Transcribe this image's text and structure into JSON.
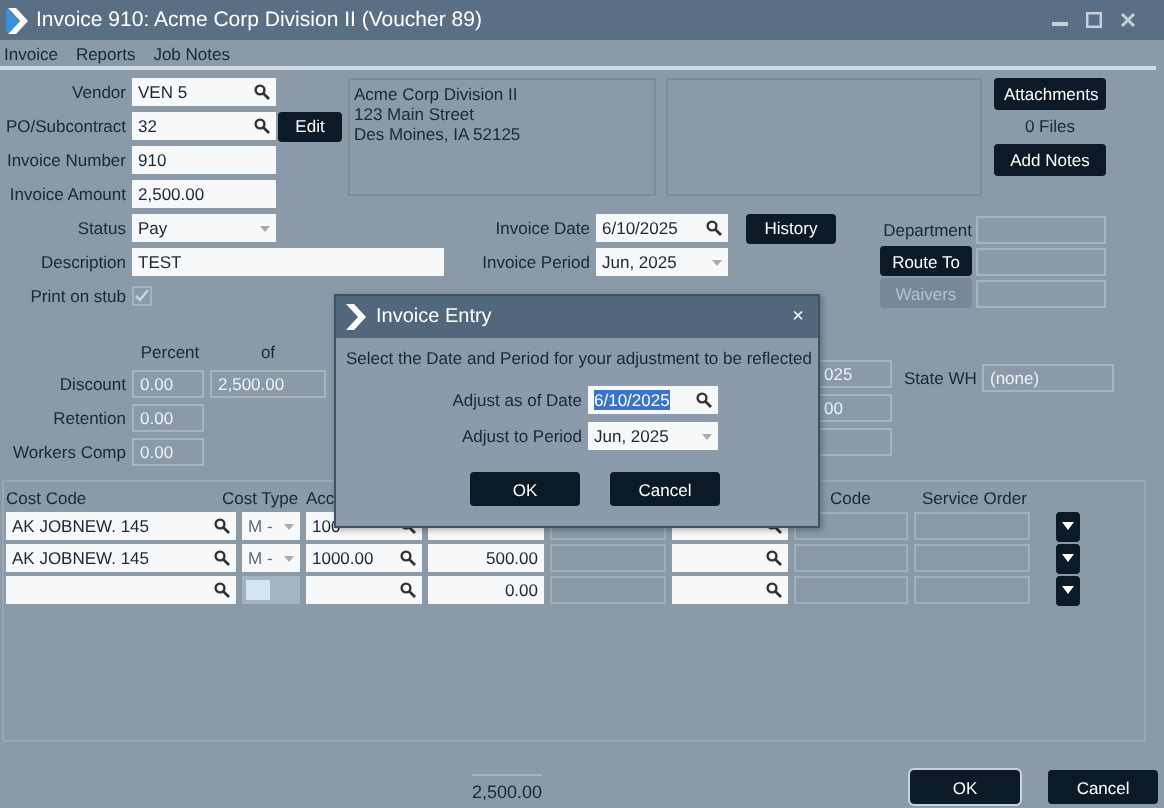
{
  "window": {
    "title": "Invoice 910: Acme Corp Division II (Voucher 89)"
  },
  "menu": [
    {
      "label": "Invoice"
    },
    {
      "label": "Reports"
    },
    {
      "label": "Job Notes"
    }
  ],
  "header_fields": [
    {
      "label": "Vendor",
      "value": "VEN 5",
      "kind": "search"
    },
    {
      "label": "PO/Subcontract",
      "value": "32",
      "kind": "search"
    },
    {
      "label": "Invoice Number",
      "value": "910",
      "kind": "text"
    },
    {
      "label": "Invoice Amount",
      "value": "2,500.00",
      "kind": "text"
    }
  ],
  "edit_button": "Edit",
  "address": {
    "lines": [
      "Acme Corp Division II",
      "123 Main Street",
      "Des Moines, IA 52125"
    ]
  },
  "attachments": {
    "button": "Attachments",
    "count": "0 Files",
    "notes_button": "Add Notes"
  },
  "detail_fields": [
    {
      "label": "Status",
      "value": "Pay",
      "kind": "select"
    },
    {
      "label": "Description",
      "value": "TEST",
      "kind": "wide"
    },
    {
      "label": "Print on stub",
      "kind": "checkbox",
      "checked": true
    }
  ],
  "date_fields": [
    {
      "label": "Invoice Date",
      "value": "6/10/2025",
      "kind": "search"
    },
    {
      "label": "Invoice Period",
      "value": "Jun, 2025",
      "kind": "select"
    }
  ],
  "history_button": "History",
  "routing": [
    {
      "kind": "label",
      "text": "Department"
    },
    {
      "kind": "button",
      "text": "Route To",
      "disabled": false
    },
    {
      "kind": "button",
      "text": "Waivers",
      "disabled": true
    }
  ],
  "deductions": {
    "headers": [
      "Percent",
      "of"
    ],
    "rows": [
      {
        "label": "Discount",
        "percent": "0.00",
        "of": "2,500.00"
      },
      {
        "label": "Retention",
        "percent": "0.00"
      },
      {
        "label": "Workers Comp",
        "percent": "0.00"
      }
    ]
  },
  "partial_fields": [
    {
      "value": "025"
    },
    {
      "value": "00"
    }
  ],
  "state_wh": {
    "label": "State WH",
    "value": "(none)"
  },
  "grid": {
    "columns": [
      "Cost Code",
      "Cost Type",
      "Acc",
      "Code",
      "Service Order"
    ],
    "rows": [
      {
        "cost_code": "AK JOBNEW. 145",
        "cost_type": "M -",
        "account": "100",
        "selected": false
      },
      {
        "cost_code": "AK JOBNEW. 145",
        "cost_type": "M -",
        "account": "1000.00",
        "amount": "500.00",
        "selected": false
      },
      {
        "amount": "0.00",
        "selected": true
      }
    ]
  },
  "footer": {
    "total": "2,500.00",
    "ok": "OK",
    "cancel": "Cancel"
  },
  "dialog": {
    "title": "Invoice Entry",
    "close": "×",
    "message": "Select the Date and Period for your adjustment to be reflected",
    "fields": [
      {
        "label": "Adjust as of Date",
        "value": "6/10/2025",
        "kind": "search",
        "selected": true
      },
      {
        "label": "Adjust to Period",
        "value": "Jun, 2025",
        "kind": "select",
        "selected": false
      }
    ],
    "ok": "OK",
    "cancel": "Cancel"
  }
}
